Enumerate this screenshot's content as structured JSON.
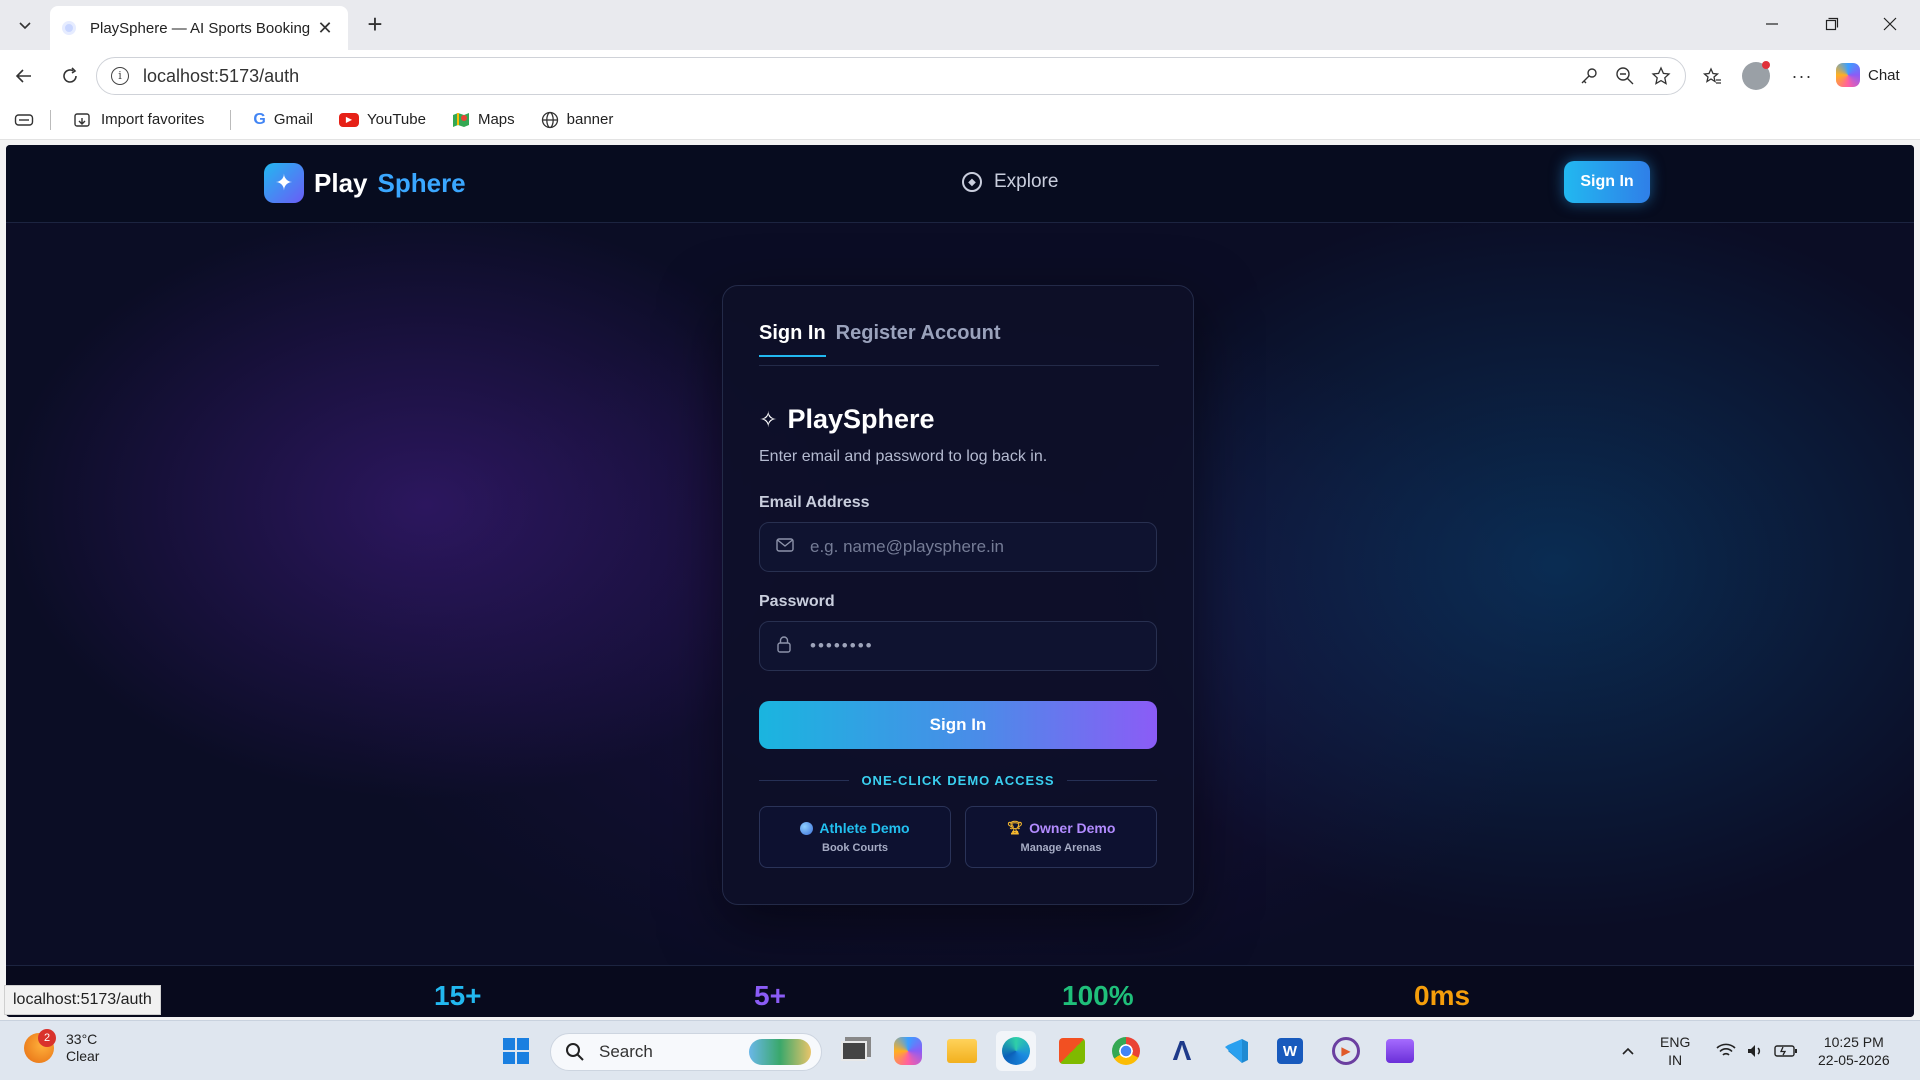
{
  "browser": {
    "tab_title": "PlaySphere — AI Sports Booking",
    "url": "localhost:5173/auth",
    "copilot_label": "Chat",
    "favorites": [
      {
        "label": "Import favorites"
      },
      {
        "label": "Gmail"
      },
      {
        "label": "YouTube"
      },
      {
        "label": "Maps"
      },
      {
        "label": "banner"
      }
    ],
    "status_url": "localhost:5173/auth"
  },
  "app": {
    "brand_first": "Play",
    "brand_second": "Sphere",
    "nav_explore": "Explore",
    "nav_signin": "Sign In",
    "colors": {
      "accent_cyan": "#22b8f0",
      "accent_purple": "#8b5cf6",
      "bg": "#0b0d25"
    }
  },
  "auth_card": {
    "tabs": [
      {
        "label": "Sign In",
        "active": true
      },
      {
        "label": "Register Account",
        "active": false
      }
    ],
    "brand": "PlaySphere",
    "subtitle": "Enter email and password to log back in.",
    "email_label": "Email Address",
    "email_placeholder": "e.g. name@playsphere.in",
    "password_label": "Password",
    "password_masked": "••••••••",
    "submit_label": "Sign In",
    "demo_heading": "ONE-CLICK DEMO ACCESS",
    "demos": [
      {
        "icon": "globe-icon",
        "title": "Athlete Demo",
        "subtitle": "Book Courts",
        "color": "#22c0f0"
      },
      {
        "icon": "trophy-icon",
        "title": "Owner Demo",
        "subtitle": "Manage Arenas",
        "color": "#b28bff"
      }
    ]
  },
  "stats": [
    {
      "value": "15+",
      "color": "#22b8f0"
    },
    {
      "value": "5+",
      "color": "#8b5cf6"
    },
    {
      "value": "100%",
      "color": "#1fbf7a"
    },
    {
      "value": "0ms",
      "color": "#f59e0b"
    }
  ],
  "taskbar": {
    "weather_temp": "33°C",
    "weather_cond": "Clear",
    "weather_badge": "2",
    "search_label": "Search",
    "lang_1": "ENG",
    "lang_2": "IN",
    "time": "10:25 PM",
    "date": "22-05-2026"
  }
}
